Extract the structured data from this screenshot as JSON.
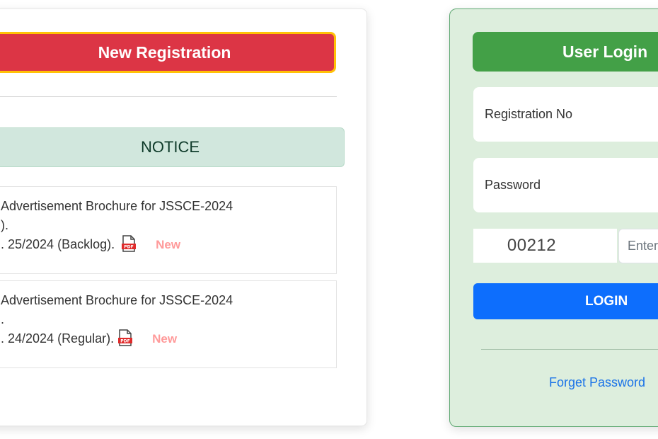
{
  "registration": {
    "new_registration_label": "New Registration"
  },
  "notice": {
    "title": "NOTICE",
    "items": [
      {
        "lines": [
          "Advertisement Brochure for JSSCE-2024",
          ").",
          ". 25/2024 (Backlog)."
        ],
        "attachment_icon": "pdf-icon",
        "badge": "New"
      },
      {
        "lines": [
          "Advertisement Brochure for JSSCE-2024",
          ".",
          ". 24/2024 (Regular)."
        ],
        "attachment_icon": "pdf-icon",
        "badge": "New"
      }
    ]
  },
  "login": {
    "title": "User Login",
    "registration_placeholder": "Registration No",
    "password_placeholder": "Password",
    "captcha_code": "00212",
    "captcha_placeholder": "Enter Captcha",
    "login_label": "LOGIN",
    "forget_password_label": "Forget Password"
  },
  "colors": {
    "registration_button": "#dc3545",
    "registration_border": "#ffc107",
    "notice_header_bg": "#d1e7dd",
    "login_header_bg": "#43a047",
    "login_card_bg": "#ddeedd",
    "login_button": "#0d6efd",
    "new_badge": "#ff9a9a",
    "link": "#1a73e8"
  }
}
